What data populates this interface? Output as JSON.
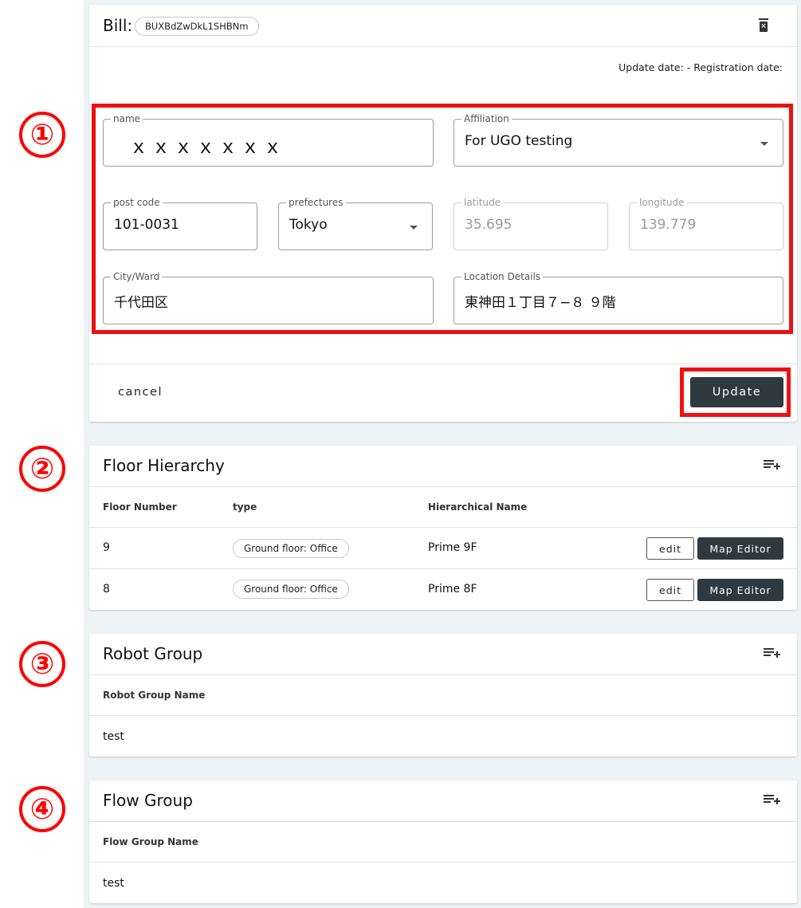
{
  "bill": {
    "title": "Bill:",
    "id": "BUXBdZwDkL1SHBNm",
    "dates": "Update date: - Registration date:",
    "fields": {
      "name": {
        "label": "name",
        "value": "ｘｘｘｘｘｘｘ"
      },
      "affiliation": {
        "label": "Affiliation",
        "value": "For UGO testing"
      },
      "post_code": {
        "label": "post code",
        "value": "101-0031"
      },
      "prefectures": {
        "label": "prefectures",
        "value": "Tokyo"
      },
      "latitude": {
        "label": "latitude",
        "value": "35.695"
      },
      "longitude": {
        "label": "longitude",
        "value": "139.779"
      },
      "city": {
        "label": "City/Ward",
        "value": "千代田区"
      },
      "location": {
        "label": "Location Details",
        "value": "東神田１丁目７−８ ９階"
      }
    },
    "cancel_label": "cancel",
    "update_label": "Update"
  },
  "annotations": [
    "①",
    "②",
    "③",
    "④"
  ],
  "floor_hierarchy": {
    "title": "Floor Hierarchy",
    "columns": [
      "Floor Number",
      "type",
      "Hierarchical Name"
    ],
    "rows": [
      {
        "floor": "9",
        "type": "Ground floor: Office",
        "name": "Prime 9F"
      },
      {
        "floor": "8",
        "type": "Ground floor: Office",
        "name": "Prime 8F"
      }
    ],
    "edit_label": "edit",
    "map_editor_label": "Map Editor"
  },
  "robot_group": {
    "title": "Robot Group",
    "column": "Robot Group Name",
    "rows": [
      "test"
    ]
  },
  "flow_group": {
    "title": "Flow Group",
    "column": "Flow Group Name",
    "rows": [
      "test"
    ]
  },
  "icons": {
    "delete": "trash-icon",
    "add": "playlist-add-icon",
    "dropdown": "caret-down-icon"
  },
  "colors": {
    "annotation_red": "#ff0000",
    "primary_button": "#2e3a40",
    "page_background": "#eef3f5"
  }
}
